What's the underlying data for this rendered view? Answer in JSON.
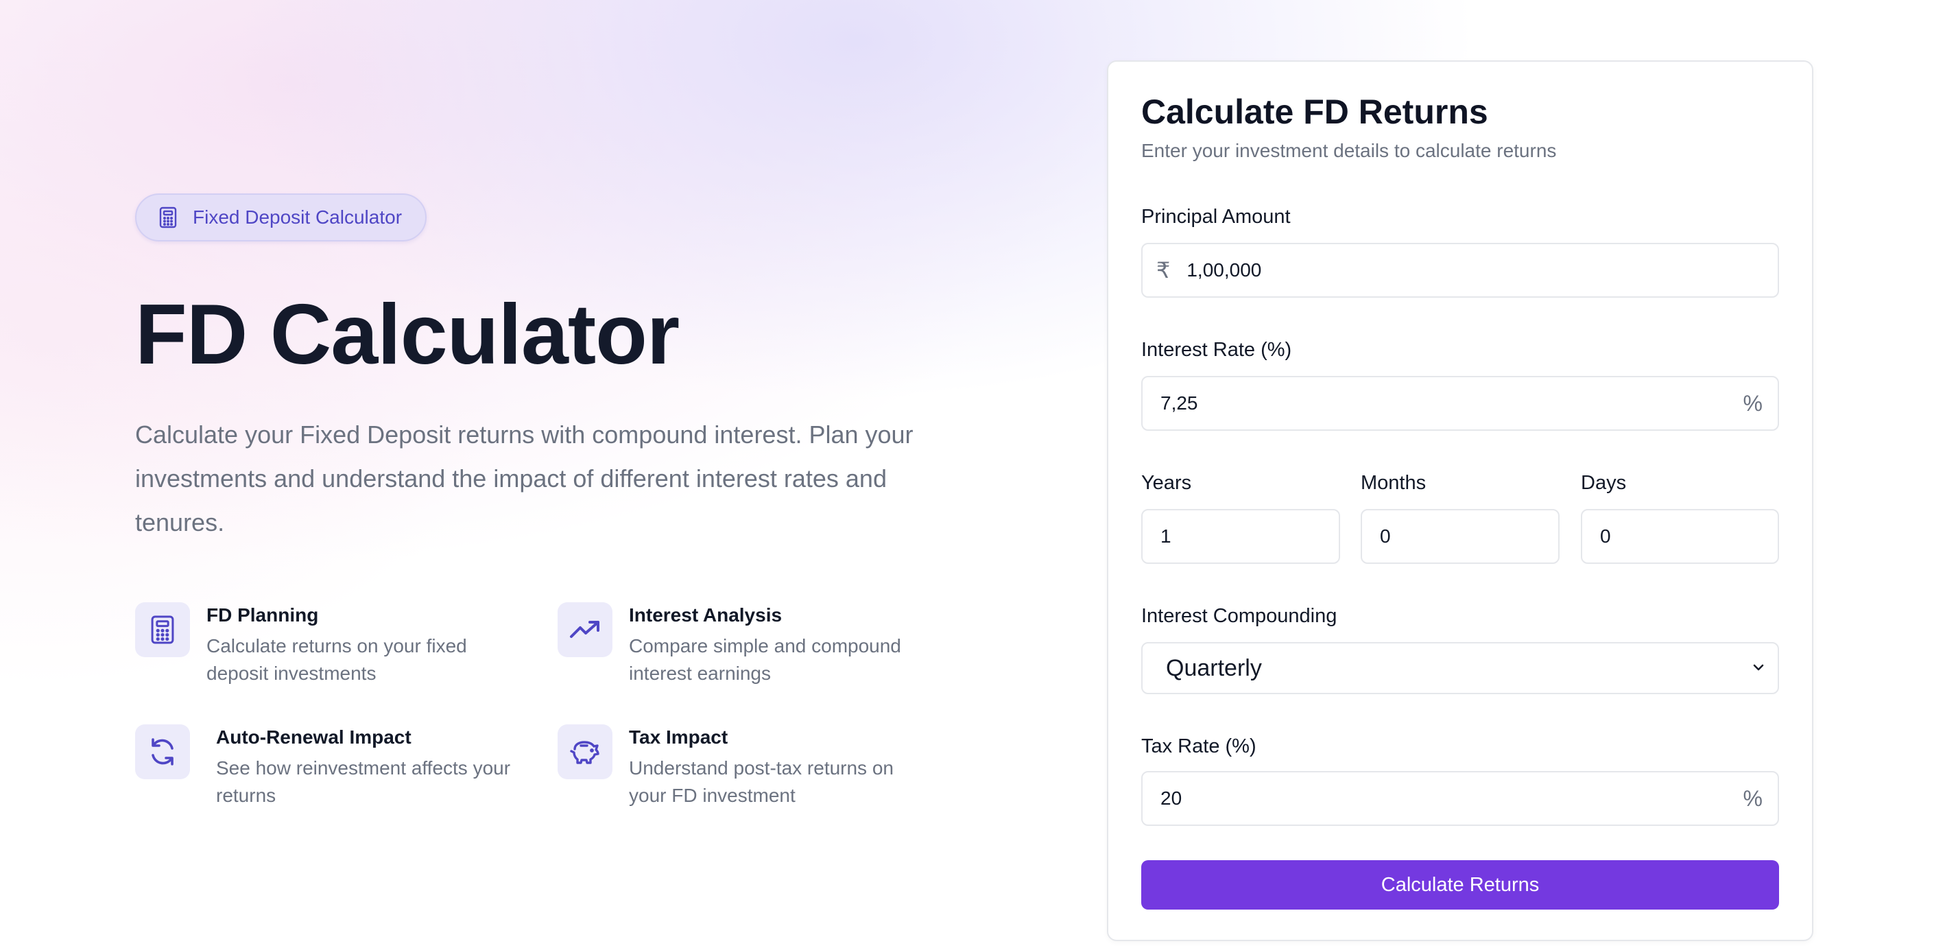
{
  "hero": {
    "badge_label": "Fixed Deposit Calculator",
    "title": "FD Calculator",
    "description": "Calculate your Fixed Deposit returns with compound interest. Plan your investments and understand the impact of different interest rates and tenures."
  },
  "features": [
    {
      "icon": "calculator-icon",
      "title": "FD Planning",
      "description": "Calculate returns on your fixed deposit investments"
    },
    {
      "icon": "trending-up-icon",
      "title": "Interest Analysis",
      "description": "Compare simple and compound interest earnings"
    },
    {
      "icon": "refresh-icon",
      "title": "Auto-Renewal Impact",
      "description": "See how reinvestment affects your returns"
    },
    {
      "icon": "piggy-bank-icon",
      "title": "Tax Impact",
      "description": "Understand post-tax returns on your FD investment"
    }
  ],
  "form": {
    "title": "Calculate FD Returns",
    "subtitle": "Enter your investment details to calculate returns",
    "principal": {
      "label": "Principal Amount",
      "prefix": "₹",
      "value": "1,00,000"
    },
    "interest_rate": {
      "label": "Interest Rate (%)",
      "value": "7,25",
      "suffix": "%"
    },
    "years": {
      "label": "Years",
      "value": "1"
    },
    "months": {
      "label": "Months",
      "value": "0"
    },
    "days": {
      "label": "Days",
      "value": "0"
    },
    "compounding": {
      "label": "Interest Compounding",
      "value": "Quarterly"
    },
    "tax_rate": {
      "label": "Tax Rate (%)",
      "value": "20",
      "suffix": "%"
    },
    "submit_label": "Calculate Returns"
  },
  "colors": {
    "accent": "#7439e0",
    "badge_text": "#4f46c5",
    "icon_bg": "#ecebfa",
    "icon_stroke": "#4f46c5"
  }
}
